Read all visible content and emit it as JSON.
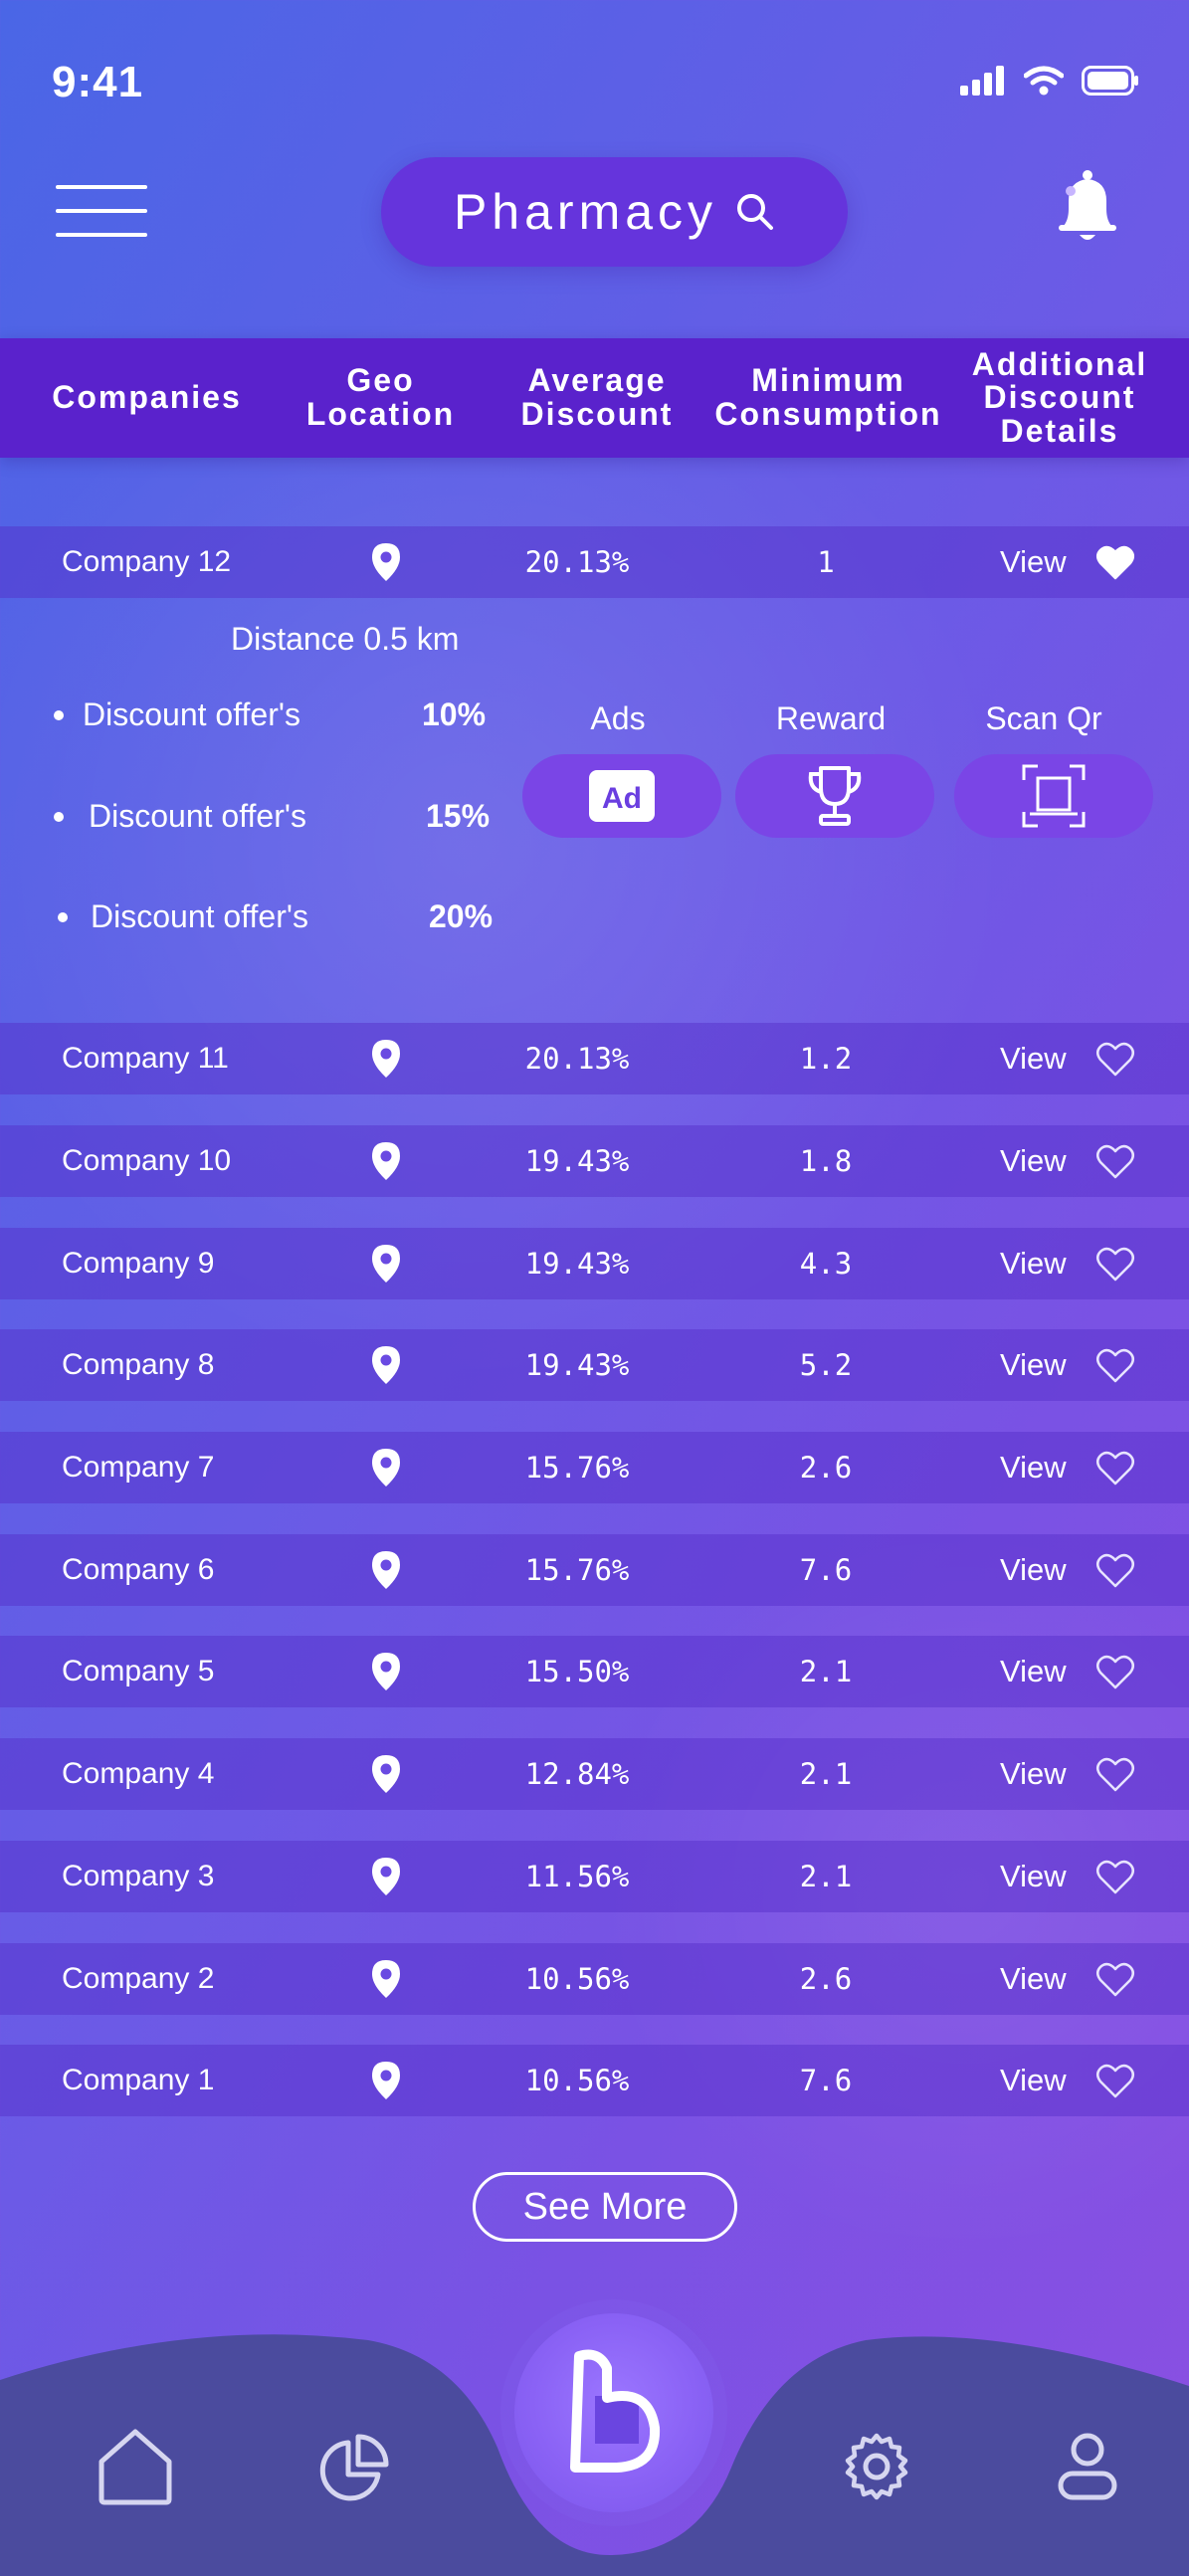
{
  "status": {
    "time": "9:41"
  },
  "header": {
    "search_label": "Pharmacy"
  },
  "table": {
    "columns": [
      "Companies",
      "Geo\nLocation",
      "Average\nDiscount",
      "Minimum\nConsumption",
      "Additional\nDiscount\nDetails"
    ],
    "rows": [
      {
        "name": "Company 12",
        "discount": "20.13%",
        "minimum": "1",
        "view": "View",
        "favorited": true
      },
      {
        "name": "Company 11",
        "discount": "20.13%",
        "minimum": "1.2",
        "view": "View",
        "favorited": false
      },
      {
        "name": "Company 10",
        "discount": "19.43%",
        "minimum": "1.8",
        "view": "View",
        "favorited": false
      },
      {
        "name": "Company 9",
        "discount": "19.43%",
        "minimum": "4.3",
        "view": "View",
        "favorited": false
      },
      {
        "name": "Company 8",
        "discount": "19.43%",
        "minimum": "5.2",
        "view": "View",
        "favorited": false
      },
      {
        "name": "Company 7",
        "discount": "15.76%",
        "minimum": "2.6",
        "view": "View",
        "favorited": false
      },
      {
        "name": "Company 6",
        "discount": "15.76%",
        "minimum": "7.6",
        "view": "View",
        "favorited": false
      },
      {
        "name": "Company 5",
        "discount": "15.50%",
        "minimum": "2.1",
        "view": "View",
        "favorited": false
      },
      {
        "name": "Company 4",
        "discount": "12.84%",
        "minimum": "2.1",
        "view": "View",
        "favorited": false
      },
      {
        "name": "Company 3",
        "discount": "11.56%",
        "minimum": "2.1",
        "view": "View",
        "favorited": false
      },
      {
        "name": "Company 2",
        "discount": "10.56%",
        "minimum": "2.6",
        "view": "View",
        "favorited": false
      },
      {
        "name": "Company 1",
        "discount": "10.56%",
        "minimum": "7.6",
        "view": "View",
        "favorited": false
      }
    ]
  },
  "details": {
    "distance": "Distance 0.5 km",
    "offers": [
      {
        "label": "Discount offer's",
        "value": "10%"
      },
      {
        "label": "Discount offer's",
        "value": "15%"
      },
      {
        "label": "Discount offer's",
        "value": "20%"
      }
    ],
    "actions": [
      {
        "label": "Ads",
        "icon": "ad-icon"
      },
      {
        "label": "Reward",
        "icon": "trophy-icon"
      },
      {
        "label": "Scan Qr",
        "icon": "scan-qr-icon"
      }
    ]
  },
  "see_more_label": "See More",
  "nav": {
    "items": [
      "home-icon",
      "pie-chart-icon",
      "brand-logo-icon",
      "settings-icon",
      "profile-icon"
    ]
  }
}
